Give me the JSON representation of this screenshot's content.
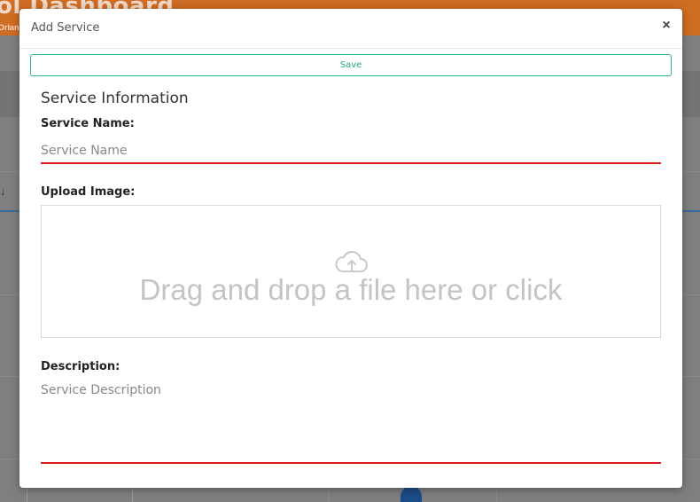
{
  "background": {
    "app_title": "ol Dashboard",
    "app_subtitle": "Orlanc",
    "sort_glyph": "↓"
  },
  "modal": {
    "title": "Add Service",
    "close_label": "×",
    "save_label": "Save",
    "section_title": "Service Information",
    "service_name": {
      "label": "Service Name:",
      "placeholder": "Service Name",
      "value": ""
    },
    "upload_image": {
      "label": "Upload Image:",
      "dropzone_text": "Drag and drop a file here or click",
      "icon": "cloud-upload-icon"
    },
    "description": {
      "label": "Description:",
      "placeholder": "Service Description",
      "value": ""
    }
  },
  "colors": {
    "header_orange": "#cf6d24",
    "save_green": "#1faa7e",
    "input_error_red": "#e01b1b"
  }
}
